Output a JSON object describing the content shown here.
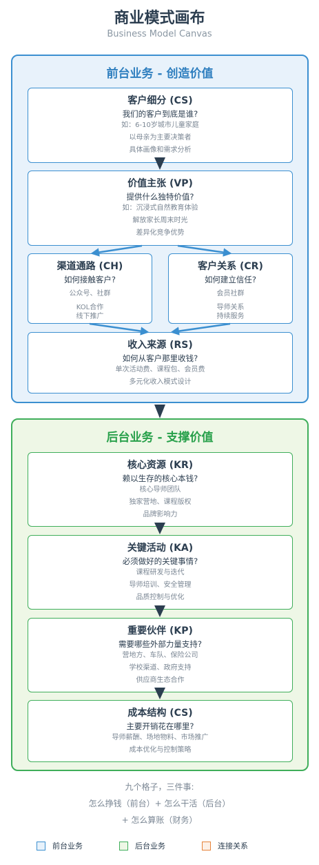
{
  "header": {
    "title": "商业模式画布",
    "subtitle": "Business Model Canvas"
  },
  "front": {
    "title": "前台业务 - 创造价值",
    "cs": {
      "title": "客户细分 (CS)",
      "question": "我们的客户到底是谁?",
      "lines": [
        "如：6-10岁城市儿童家庭",
        "以母亲为主要决策者",
        "具体画像和需求分析"
      ]
    },
    "vp": {
      "title": "价值主张 (VP)",
      "question": "提供什么独特价值?",
      "lines": [
        "如：沉浸式自然教育体验",
        "解放家长周末时光",
        "差异化竞争优势"
      ]
    },
    "ch": {
      "title": "渠道通路 (CH)",
      "question": "如何接触客户?",
      "lines": [
        "公众号、社群",
        "KOL合作",
        "线下推广"
      ]
    },
    "cr": {
      "title": "客户关系 (CR)",
      "question": "如何建立信任?",
      "lines": [
        "会员社群",
        "导师关系",
        "持续服务"
      ]
    },
    "rs": {
      "title": "收入来源 (RS)",
      "question": "如何从客户那里收钱?",
      "lines": [
        "单次活动费、课程包、会员费",
        "多元化收入模式设计"
      ]
    }
  },
  "back": {
    "title": "后台业务 - 支撑价值",
    "kr": {
      "title": "核心资源 (KR)",
      "question": "赖以生存的核心本钱?",
      "lines": [
        "核心导师团队",
        "独家营地、课程版权",
        "品牌影响力"
      ]
    },
    "ka": {
      "title": "关键活动 (KA)",
      "question": "必须做好的关键事情?",
      "lines": [
        "课程研发与迭代",
        "导师培训、安全管理",
        "品质控制与优化"
      ]
    },
    "kp": {
      "title": "重要伙伴 (KP)",
      "question": "需要哪些外部力量支持?",
      "lines": [
        "营地方、车队、保险公司",
        "学校渠道、政府支持",
        "供应商生态合作"
      ]
    },
    "cs": {
      "title": "成本结构 (CS)",
      "question": "主要开销花在哪里?",
      "lines": [
        "导师薪酬、场地物料、市场推广",
        "成本优化与控制策略"
      ]
    }
  },
  "footer": {
    "lines": [
      "九个格子，三件事:",
      "怎么挣钱（前台）+ 怎么干活（后台）",
      "+ 怎么算账（财务）"
    ]
  },
  "legend": [
    {
      "label": "前台业务",
      "color": "#3b8fd0",
      "fill": "#e8f2fb"
    },
    {
      "label": "后台业务",
      "color": "#3fae5a",
      "fill": "#eef7e6"
    },
    {
      "label": "连接关系",
      "color": "#e6833a",
      "fill": "#fdf1e7"
    }
  ],
  "colors": {
    "arrow_blue": "#3b8fd0",
    "arrow_dark": "#2c3e50"
  }
}
